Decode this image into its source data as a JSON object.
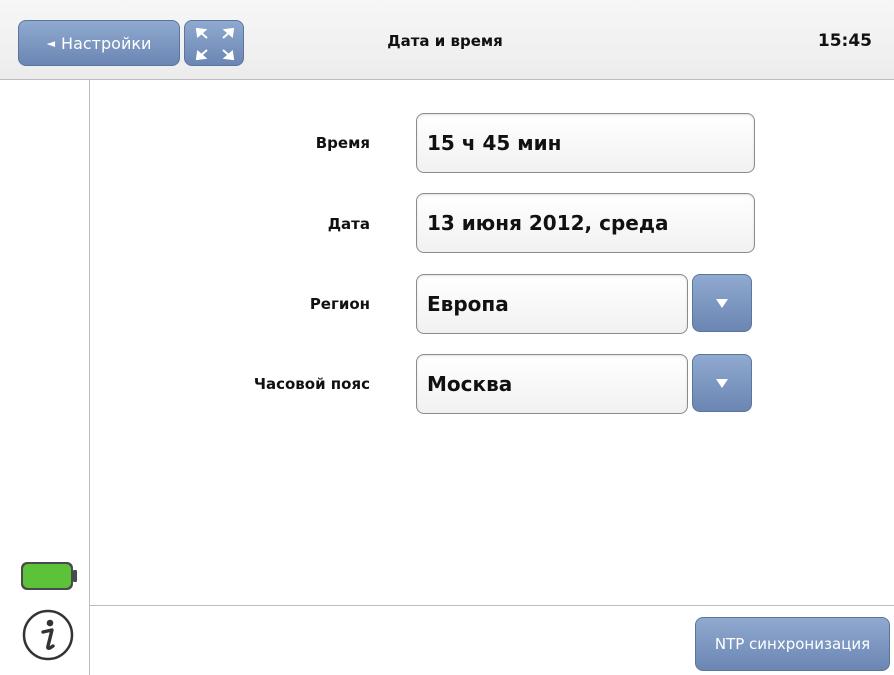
{
  "header": {
    "back_label": "Настройки",
    "back_arrow": "◄",
    "title": "Дата и время",
    "clock": "15:45"
  },
  "form": {
    "time": {
      "label": "Время",
      "value": "15 ч 45 мин"
    },
    "date": {
      "label": "Дата",
      "value": "13 июня 2012, среда"
    },
    "region": {
      "label": "Регион",
      "value": "Европа"
    },
    "timezone": {
      "label": "Часовой пояс",
      "value": "Москва"
    }
  },
  "footer": {
    "ntp_label": "NTP синхронизация"
  },
  "sidebar": {
    "battery_icon": "battery-icon",
    "info_icon": "info-icon"
  },
  "colors": {
    "button_top": "#8fa9cf",
    "button_bottom": "#6b86b3",
    "battery_green": "#5cc23a"
  }
}
